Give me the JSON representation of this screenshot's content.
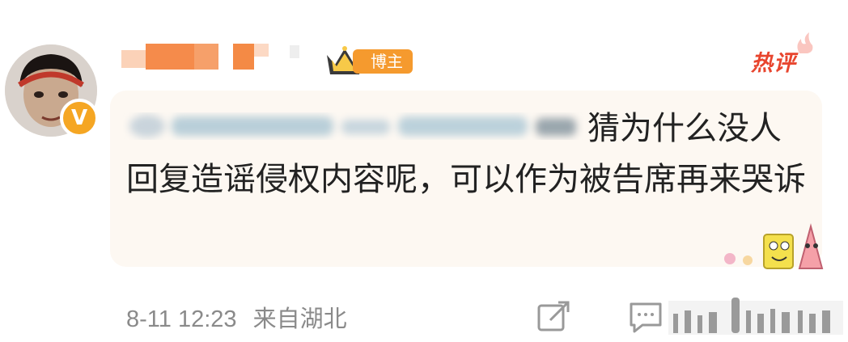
{
  "comment": {
    "badge_label": "博主",
    "hot_label": "热评",
    "text": "猜为什么没人回复造谣侵权内容呢，可以作为被告席再来哭诉",
    "timestamp": "8-11 12:23",
    "location": "来自湖北"
  },
  "colors": {
    "badge_orange": "#f59a2e",
    "hot_red": "#e8452e",
    "bubble_bg": "#fdf8f2",
    "meta_gray": "#8a8a8a"
  },
  "icons": [
    "verified-v-icon",
    "crown-icon",
    "hot-flame-icon",
    "share-icon",
    "reply-icon",
    "like-icon"
  ]
}
